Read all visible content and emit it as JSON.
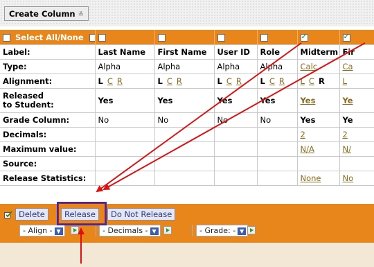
{
  "toolbar": {
    "create_column_label": "Create Column",
    "sort_glyph": "≚"
  },
  "header": {
    "select_all_label": "Select All/None",
    "columns_checked": [
      false,
      false,
      false,
      false,
      true,
      true
    ]
  },
  "columns": [
    "Last Name",
    "First Name",
    "User ID",
    "Role",
    "Midterm",
    "Fir"
  ],
  "rows": {
    "label": {
      "label": "Label:"
    },
    "type": {
      "label": "Type:",
      "values": [
        "Alpha",
        "Alpha",
        "Alpha",
        "Alpha",
        "Calc",
        "Ca"
      ]
    },
    "alignment": {
      "label": "Alignment:",
      "values": [
        [
          "L",
          "C",
          "R"
        ],
        [
          "L",
          "C",
          "R"
        ],
        [
          "L",
          "C",
          "R"
        ],
        [
          "L",
          "C",
          "R"
        ],
        [
          "L",
          "C",
          "R"
        ],
        [
          "L",
          "",
          ""
        ]
      ]
    },
    "released": {
      "label_line1": "Released",
      "label_line2": "to Student:",
      "values": [
        "Yes",
        "Yes",
        "Yes",
        "Yes",
        "Yes",
        "Ye"
      ]
    },
    "grade_col": {
      "label": "Grade Column:",
      "values": [
        "No",
        "No",
        "No",
        "No",
        "Yes",
        "Ye"
      ]
    },
    "decimals": {
      "label": "Decimals:",
      "values": [
        "",
        "",
        "",
        "",
        "2",
        "2"
      ]
    },
    "max_value": {
      "label": "Maximum value:",
      "values": [
        "",
        "",
        "",
        "",
        "N/A",
        "N/"
      ]
    },
    "source": {
      "label": "Source:"
    },
    "release_stats": {
      "label": "Release Statistics:",
      "values": [
        "",
        "",
        "",
        "",
        "None",
        "No"
      ]
    }
  },
  "actions": {
    "delete_label": "Delete",
    "release_label": "Release",
    "do_not_release_label": "Do Not Release",
    "align_select": "- Align -",
    "decimals_select": "- Decimals -",
    "grade_select": "- Grade: -"
  },
  "colors": {
    "header_orange": "#e8861b",
    "link_brown": "#8a6a1c",
    "annotation_red": "#dd1111",
    "highlight_blue": "#2c2cc8"
  }
}
